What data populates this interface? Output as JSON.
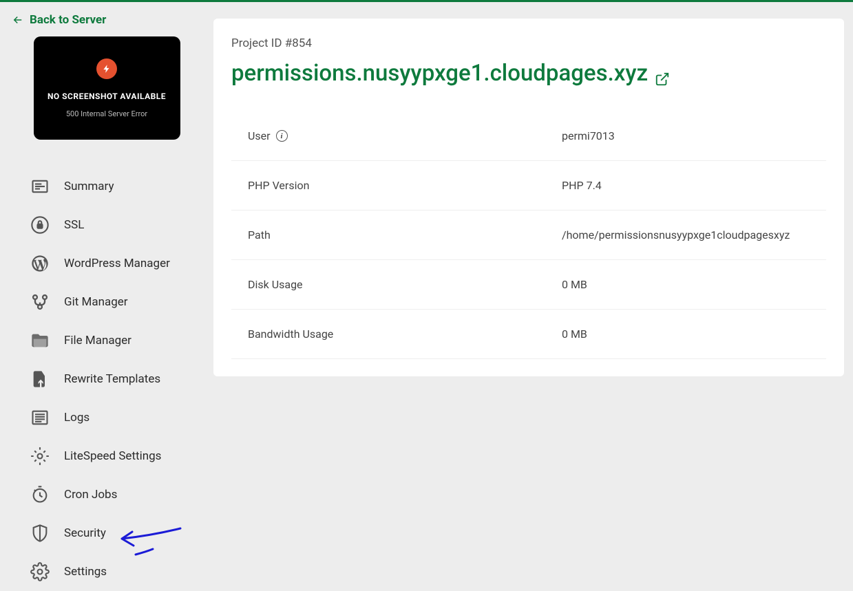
{
  "header": {
    "back_label": "Back to Server"
  },
  "screenshot_preview": {
    "title": "NO SCREENSHOT AVAILABLE",
    "subtitle": "500 Internal Server Error"
  },
  "sidebar": {
    "items": [
      {
        "label": "Summary"
      },
      {
        "label": "SSL"
      },
      {
        "label": "WordPress Manager"
      },
      {
        "label": "Git Manager"
      },
      {
        "label": "File Manager"
      },
      {
        "label": "Rewrite Templates"
      },
      {
        "label": "Logs"
      },
      {
        "label": "LiteSpeed Settings"
      },
      {
        "label": "Cron Jobs"
      },
      {
        "label": "Security"
      },
      {
        "label": "Settings"
      }
    ]
  },
  "main": {
    "project_id_label": "Project ID #854",
    "domain": "permissions.nusyypxge1.cloudpages.xyz",
    "rows": [
      {
        "label": "User",
        "value": "permi7013",
        "has_info": true
      },
      {
        "label": "PHP Version",
        "value": "PHP 7.4"
      },
      {
        "label": "Path",
        "value": "/home/permissionsnusyypxge1cloudpagesxyz"
      },
      {
        "label": "Disk Usage",
        "value": "0 MB"
      },
      {
        "label": "Bandwidth Usage",
        "value": "0 MB"
      }
    ]
  }
}
